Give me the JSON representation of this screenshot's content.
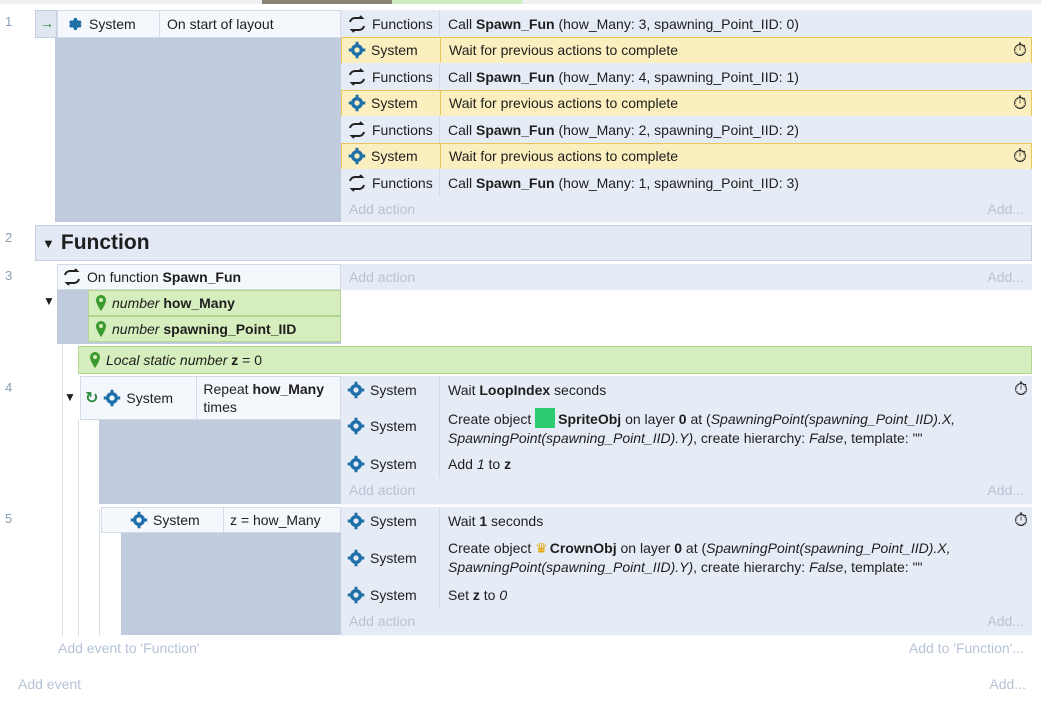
{
  "line_numbers": [
    "1",
    "2",
    "3",
    "4",
    "5"
  ],
  "ev1": {
    "cond_object": "System",
    "cond_text": "On start of layout",
    "actions": [
      {
        "object": "Functions",
        "prefix": "Call ",
        "name": "Spawn_Fun",
        "args": " (how_Many: 3, spawning_Point_IID: 0)"
      },
      {
        "object": "System",
        "text": "Wait for previous actions to complete"
      },
      {
        "object": "Functions",
        "prefix": "Call ",
        "name": "Spawn_Fun",
        "args": " (how_Many: 4, spawning_Point_IID: 1)"
      },
      {
        "object": "System",
        "text": "Wait for previous actions to complete"
      },
      {
        "object": "Functions",
        "prefix": "Call ",
        "name": "Spawn_Fun",
        "args": " (how_Many: 2, spawning_Point_IID: 2)"
      },
      {
        "object": "System",
        "text": "Wait for previous actions to complete"
      },
      {
        "object": "Functions",
        "prefix": "Call ",
        "name": "Spawn_Fun",
        "args": " (how_Many: 1, spawning_Point_IID: 3)"
      }
    ],
    "add_action": "Add action",
    "add_more": "Add..."
  },
  "group": {
    "title": "Function"
  },
  "ev3": {
    "on_function": "On function ",
    "function_name": "Spawn_Fun",
    "params": [
      {
        "type": "number",
        "name": "how_Many"
      },
      {
        "type": "number",
        "name": "spawning_Point_IID"
      }
    ],
    "add_action": "Add action",
    "add_more": "Add..."
  },
  "local_var": {
    "prefix": "Local static number ",
    "name": "z",
    "suffix": " = 0"
  },
  "ev4": {
    "cond_object": "System",
    "cond_prefix": "Repeat ",
    "cond_bold": "how_Many",
    "cond_suffix": "times",
    "actions": {
      "a1": {
        "object": "System",
        "pre": "Wait ",
        "bold": "LoopIndex",
        "post": " seconds"
      },
      "a2": {
        "object": "System",
        "pre": "Create object ",
        "bold": "SpriteObj",
        "mid": " on layer ",
        "layer": "0",
        "at": " at (",
        "l1": "SpawningPoint(spawning_Point_IID).X,",
        "l2": "SpawningPoint(spawning_Point_IID).Y)",
        "tail": ", create hierarchy: ",
        "hier": "False",
        "tail2": ", template: \"\""
      },
      "a3": {
        "object": "System",
        "pre": "Add ",
        "num": "1",
        "mid": " to ",
        "bold": "z"
      }
    },
    "add_action": "Add action",
    "add_more": "Add..."
  },
  "ev5": {
    "cond_object": "System",
    "cond_text": "z = how_Many",
    "actions": {
      "a1": {
        "object": "System",
        "pre": "Wait ",
        "bold": "1",
        "post": " seconds"
      },
      "a2": {
        "object": "System",
        "pre": "Create object ",
        "bold": "CrownObj",
        "mid": " on layer ",
        "layer": "0",
        "at": " at (",
        "l1": "SpawningPoint(spawning_Point_IID).X,",
        "l2": "SpawningPoint(spawning_Point_IID).Y)",
        "tail": ", create hierarchy: ",
        "hier": "False",
        "tail2": ", template: \"\""
      },
      "a3": {
        "object": "System",
        "pre": "Set ",
        "bold": "z",
        "mid": " to ",
        "num": "0"
      }
    },
    "add_action": "Add action",
    "add_more": "Add..."
  },
  "footer": {
    "add_event_function": "Add event to 'Function'",
    "add_to_function": "Add to 'Function'...",
    "add_event": "Add event",
    "add_more": "Add..."
  },
  "colors": {
    "accent_green": "#2ecc71",
    "gear_blue": "#1f6fa8",
    "wait_bg": "#fbefbf"
  }
}
